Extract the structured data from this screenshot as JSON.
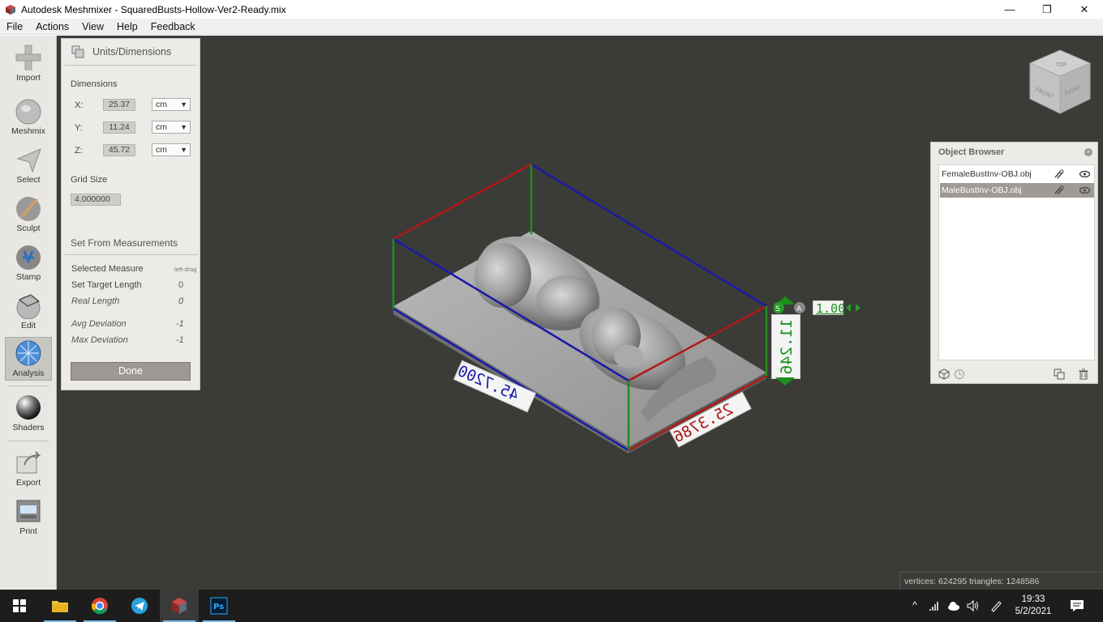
{
  "window": {
    "title": "Autodesk Meshmixer - SquaredBusts-Hollow-Ver2-Ready.mix",
    "minimize": "—",
    "maximize": "❐",
    "close": "✕"
  },
  "menu": [
    "File",
    "Actions",
    "View",
    "Help",
    "Feedback"
  ],
  "toolbar": {
    "items": [
      {
        "label": "Import",
        "icon": "plus-icon"
      },
      {
        "label": "Meshmix",
        "icon": "bunny-icon"
      },
      {
        "label": "Select",
        "icon": "arrow-icon"
      },
      {
        "label": "Sculpt",
        "icon": "brush-icon"
      },
      {
        "label": "Stamp",
        "icon": "stamp-icon"
      },
      {
        "label": "Edit",
        "icon": "edit-sphere-icon"
      },
      {
        "label": "Analysis",
        "icon": "analysis-icon",
        "active": true
      },
      {
        "label": "Shaders",
        "icon": "sphere-icon"
      },
      {
        "label": "Export",
        "icon": "export-icon"
      },
      {
        "label": "Print",
        "icon": "printer-icon"
      }
    ]
  },
  "units_panel": {
    "title": "Units/Dimensions",
    "dimensions_label": "Dimensions",
    "x_label": "X:",
    "x_value": "25.37",
    "x_unit": "cm",
    "y_label": "Y:",
    "y_value": "11.24",
    "y_unit": "cm",
    "z_label": "Z:",
    "z_value": "45.72",
    "z_unit": "cm",
    "grid_size_label": "Grid Size",
    "grid_size_value": "4.000000",
    "set_from_label": "Set From Measurements",
    "selected_measure_label": "Selected Measure",
    "selected_measure_value": "left-drag",
    "set_target_label": "Set Target Length",
    "set_target_value": "0",
    "real_length_label": "Real Length",
    "real_length_value": "0",
    "avg_dev_label": "Avg Deviation",
    "avg_dev_value": "-1",
    "max_dev_label": "Max Deviation",
    "max_dev_value": "-1",
    "done_label": "Done"
  },
  "viewport": {
    "dim_x": "25.3786",
    "dim_y": "11.246",
    "dim_z": "45.7200",
    "scale_value": "1.00",
    "colors": {
      "x_axis": "#b01818",
      "y_axis": "#1b8f1b",
      "z_axis": "#1a1aa8",
      "background": "#3b3b38"
    },
    "viewcube": {
      "top": "TOP",
      "front": "FRONT",
      "right": "RIGHT"
    }
  },
  "object_browser": {
    "title": "Object Browser",
    "items": [
      {
        "name": "FemaleBustInv-OBJ.obj",
        "selected": false
      },
      {
        "name": "MaleBustInv-OBJ.obj",
        "selected": true
      }
    ]
  },
  "status": {
    "text": "vertices: 624295 triangles: 1248586"
  },
  "taskbar": {
    "time": "19:33",
    "date": "5/2/2021"
  }
}
